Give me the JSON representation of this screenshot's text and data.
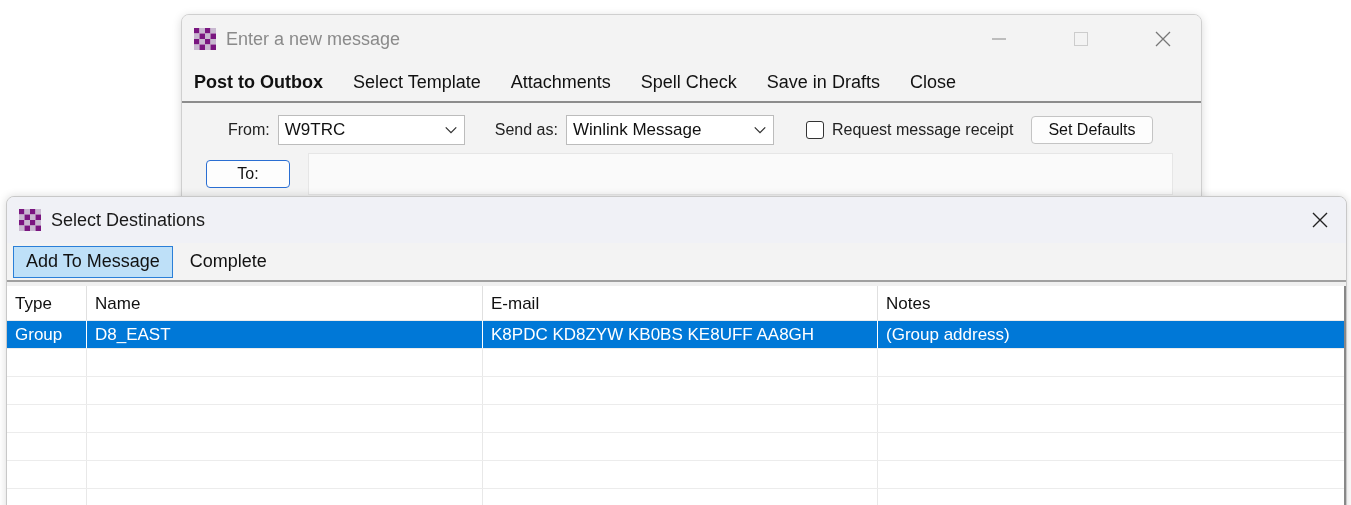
{
  "message_window": {
    "title": "Enter a new message",
    "menu": [
      {
        "label": "Post to Outbox",
        "default": true
      },
      {
        "label": "Select Template",
        "default": false
      },
      {
        "label": "Attachments",
        "default": false
      },
      {
        "label": "Spell Check",
        "default": false
      },
      {
        "label": "Save in Drafts",
        "default": false
      },
      {
        "label": "Close",
        "default": false
      }
    ],
    "from": {
      "label": "From:",
      "value": "W9TRC"
    },
    "send_as": {
      "label": "Send as:",
      "value": "Winlink Message"
    },
    "receipt": {
      "label": "Request message receipt",
      "checked": false
    },
    "set_defaults": "Set Defaults",
    "to": {
      "label": "To:"
    }
  },
  "destinations_window": {
    "title": "Select Destinations",
    "toolbar": [
      {
        "label": "Add To Message",
        "selected": true
      },
      {
        "label": "Complete",
        "selected": false
      }
    ],
    "columns": [
      "Type",
      "Name",
      "E-mail",
      "Notes"
    ],
    "rows": [
      {
        "cells": [
          "Group",
          "D8_EAST",
          "K8PDC KD8ZYW KB0BS KE8UFF AA8GH",
          "(Group address)"
        ],
        "selected": true
      }
    ]
  }
}
